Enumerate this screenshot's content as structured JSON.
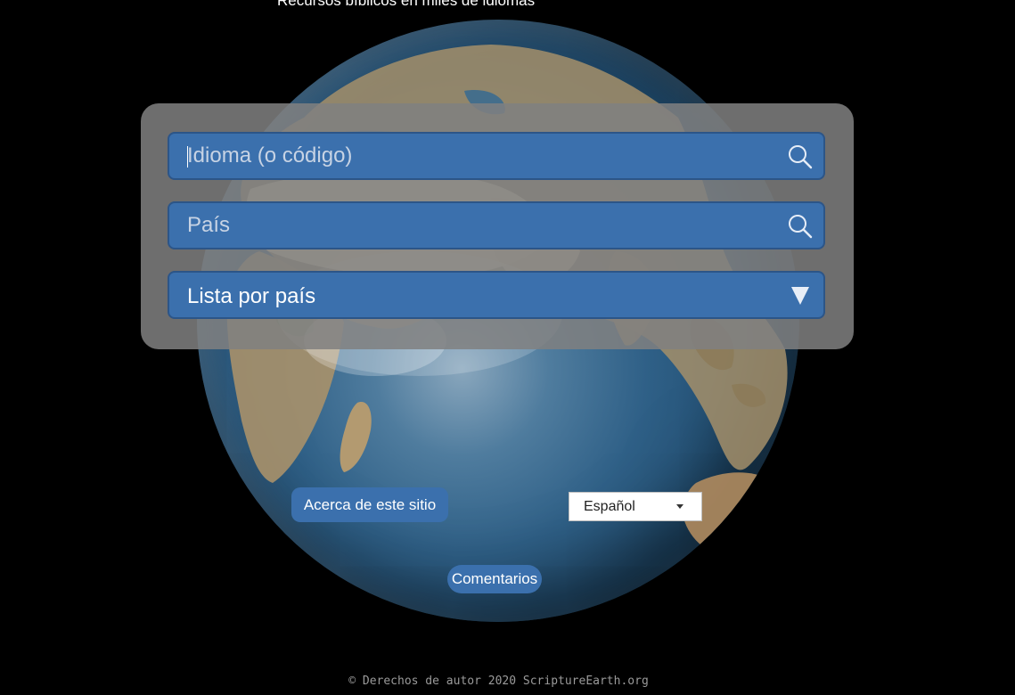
{
  "header": {
    "tagline": "Recursos bíblicos en miles de idiomas"
  },
  "search": {
    "language_placeholder": "Idioma (o código)",
    "country_placeholder": "País",
    "list_by_country_label": "Lista por país"
  },
  "buttons": {
    "about_label": "Acerca de este sitio",
    "feedback_label": "Comentarios"
  },
  "language_select": {
    "selected": "Español"
  },
  "footer": {
    "copyright": "© Derechos de autor 2020 ScriptureEarth.org"
  },
  "colors": {
    "background": "#000000",
    "field_blue": "#3b70ad",
    "panel_gray": "#808080",
    "ocean": "#2f6087"
  },
  "icons": {
    "search": "search-icon",
    "dropdown": "triangle-down-icon",
    "select_arrow": "caret-down-icon"
  }
}
